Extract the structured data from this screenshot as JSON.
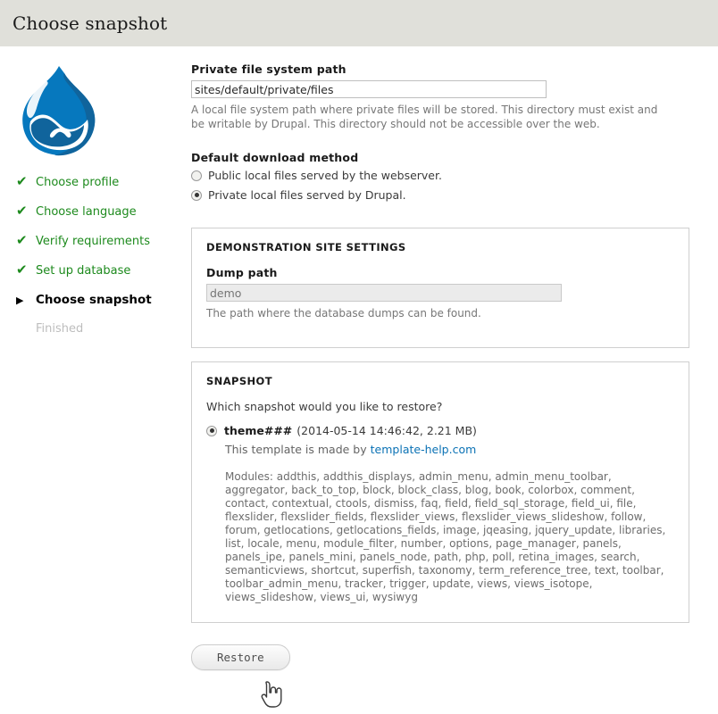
{
  "header": {
    "title": "Choose snapshot"
  },
  "sidebar": {
    "logo_alt": "drupal-droplet-logo",
    "tasks": [
      {
        "label": "Choose profile",
        "state": "done",
        "marker": "✔"
      },
      {
        "label": "Choose language",
        "state": "done",
        "marker": "✔"
      },
      {
        "label": "Verify requirements",
        "state": "done",
        "marker": "✔"
      },
      {
        "label": "Set up database",
        "state": "done",
        "marker": "✔"
      },
      {
        "label": "Choose snapshot",
        "state": "active",
        "marker": "▶"
      },
      {
        "label": "Finished",
        "state": "pending",
        "marker": ""
      }
    ]
  },
  "form": {
    "private_path": {
      "label": "Private file system path",
      "value": "sites/default/private/files",
      "placeholder": "",
      "description": "A local file system path where private files will be stored. This directory must exist and be writable by Drupal. This directory should not be accessible over the web."
    },
    "download_method": {
      "label": "Default download method",
      "options": [
        {
          "label": "Public local files served by the webserver.",
          "selected": false
        },
        {
          "label": "Private local files served by Drupal.",
          "selected": true
        }
      ]
    }
  },
  "demo_fieldset": {
    "legend": "DEMONSTRATION SITE SETTINGS",
    "dump_path": {
      "label": "Dump path",
      "value": "",
      "placeholder": "demo",
      "description": "The path where the database dumps can be found."
    }
  },
  "snapshot_fieldset": {
    "legend": "SNAPSHOT",
    "intro": "Which snapshot would you like to restore?",
    "option": {
      "name": "theme###",
      "meta": "(2014-05-14 14:46:42, 2.21 MB)",
      "selected": true,
      "credit_prefix": "This template is made by",
      "credit_link": "template-help.com",
      "modules": "Modules: addthis, addthis_displays, admin_menu, admin_menu_toolbar, aggregator, back_to_top, block, block_class, blog, book, colorbox, comment, contact, contextual, ctools, dismiss, faq, field, field_sql_storage, field_ui, file, flexslider, flexslider_fields, flexslider_views, flexslider_views_slideshow, follow, forum, getlocations, getlocations_fields, image, jqeasing, jquery_update, libraries, list, locale, menu, module_filter, number, options, page_manager, panels, panels_ipe, panels_mini, panels_node, path, php, poll, retina_images, search, semanticviews, shortcut, superfish, taxonomy, term_reference_tree, text, toolbar, toolbar_admin_menu, tracker, trigger, update, views, views_isotope, views_slideshow, views_ui, wysiwyg"
    }
  },
  "actions": {
    "restore_label": "Restore"
  },
  "colors": {
    "header_bg": "#e0e0da",
    "done_green": "#1d8a1d",
    "link_blue": "#0b72b5",
    "drupal_blue": "#0678be",
    "drupal_dark": "#10649c"
  }
}
